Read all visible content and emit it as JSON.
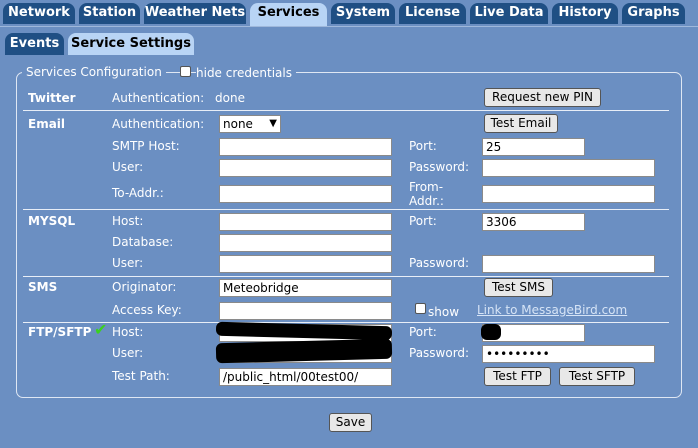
{
  "top_tabs": [
    "Network",
    "Station",
    "Weather Nets",
    "Services",
    "System",
    "License",
    "Live Data",
    "History",
    "Graphs"
  ],
  "sub_tabs": [
    "Events",
    "Service Settings"
  ],
  "fieldset": {
    "legend": "Services Configuration",
    "hide_credentials": "hide credentials"
  },
  "twitter": {
    "section": "Twitter",
    "auth_label": "Authentication:",
    "auth_value": "done",
    "button": "Request new PIN"
  },
  "email": {
    "section": "Email",
    "auth_label": "Authentication:",
    "auth_value": "none",
    "button": "Test Email",
    "smtp_label": "SMTP Host:",
    "smtp_value": "",
    "port_label": "Port:",
    "port_value": "25",
    "user_label": "User:",
    "user_value": "",
    "password_label": "Password:",
    "password_value": "",
    "to_label": "To-Addr.:",
    "to_value": "",
    "from_label": "From-Addr.:",
    "from_value": ""
  },
  "mysql": {
    "section": "MYSQL",
    "host_label": "Host:",
    "host_value": "",
    "port_label": "Port:",
    "port_value": "3306",
    "db_label": "Database:",
    "db_value": "",
    "user_label": "User:",
    "user_value": "",
    "password_label": "Password:",
    "password_value": ""
  },
  "sms": {
    "section": "SMS",
    "orig_label": "Originator:",
    "orig_value": "Meteobridge",
    "button": "Test SMS",
    "key_label": "Access Key:",
    "key_value": "",
    "show_label": "show",
    "link": "Link to MessageBird.com"
  },
  "ftp": {
    "section": "FTP/SFTP",
    "check": "✔",
    "host_label": "Host:",
    "port_label": "Port:",
    "user_label": "User:",
    "password_label": "Password:",
    "password_value": "•••••••••",
    "testpath_label": "Test Path:",
    "testpath_value": "/public_html/00test00/",
    "button_ftp": "Test FTP",
    "button_sftp": "Test SFTP"
  },
  "save": "Save",
  "colors": {
    "background": "#6b8fc2",
    "tab_inactive": "#1f4f84",
    "tab_active": "#b8d4f5",
    "check": "#3bd11f"
  }
}
